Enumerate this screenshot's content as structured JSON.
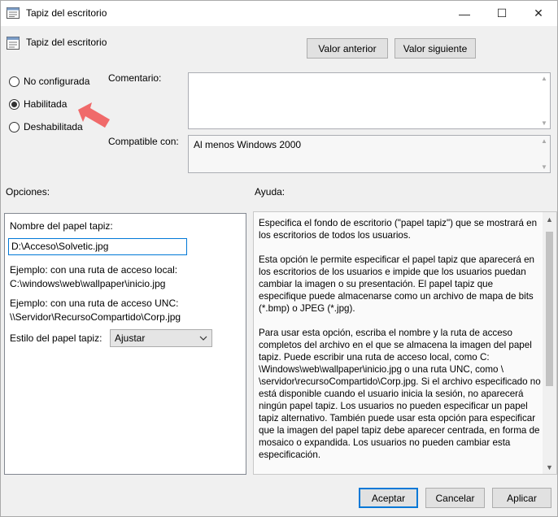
{
  "window": {
    "title": "Tapiz del escritorio",
    "controls": {
      "minimize": "—",
      "maximize": "☐",
      "close": "✕"
    }
  },
  "header": {
    "policy_name": "Tapiz del escritorio",
    "prev_button": "Valor anterior",
    "next_button": "Valor siguiente"
  },
  "state": {
    "options": [
      {
        "label": "No configurada",
        "checked": false
      },
      {
        "label": "Habilitada",
        "checked": true
      },
      {
        "label": "Deshabilitada",
        "checked": false
      }
    ]
  },
  "comment": {
    "label": "Comentario:",
    "value": ""
  },
  "compatible": {
    "label": "Compatible con:",
    "value": "Al menos Windows 2000"
  },
  "options_section": {
    "label": "Opciones:",
    "wallpaper_name_label": "Nombre del papel tapiz:",
    "wallpaper_name_value": "D:\\Acceso\\Solvetic.jpg",
    "example_local_1": "Ejemplo: con una ruta de acceso local:",
    "example_local_2": "C:\\windows\\web\\wallpaper\\inicio.jpg",
    "example_unc_1": "Ejemplo: con una ruta de acceso UNC:",
    "example_unc_2": "\\\\Servidor\\RecursoCompartido\\Corp.jpg",
    "style_label": "Estilo del papel tapiz:",
    "style_value": "Ajustar"
  },
  "help_section": {
    "label": "Ayuda:",
    "paragraphs": [
      "Especifica el fondo de escritorio (\"papel tapiz\") que se mostrará en los escritorios de todos los usuarios.",
      "Esta opción le permite especificar el papel tapiz que aparecerá en los escritorios de los usuarios e impide que los usuarios puedan cambiar la imagen o su presentación. El papel tapiz que especifique puede almacenarse como un archivo de mapa de bits (*.bmp) o JPEG (*.jpg).",
      "Para usar esta opción, escriba el nombre y la ruta de acceso completos del archivo en el que se almacena la imagen del papel tapiz. Puede escribir una ruta de acceso local, como C: \\Windows\\web\\wallpaper\\inicio.jpg o una ruta UNC, como \\ \\servidor\\recursoCompartido\\Corp.jpg. Si el archivo especificado no está disponible cuando el usuario inicia la sesión, no aparecerá ningún papel tapiz. Los usuarios no pueden especificar un papel tapiz alternativo. También puede usar esta opción para especificar que la imagen del papel tapiz debe aparecer centrada, en forma de mosaico o expandida. Los usuarios no pueden cambiar esta especificación."
    ]
  },
  "footer": {
    "accept": "Aceptar",
    "cancel": "Cancelar",
    "apply": "Aplicar"
  },
  "colors": {
    "accent": "#0078d7",
    "arrow": "#f06a6a"
  }
}
